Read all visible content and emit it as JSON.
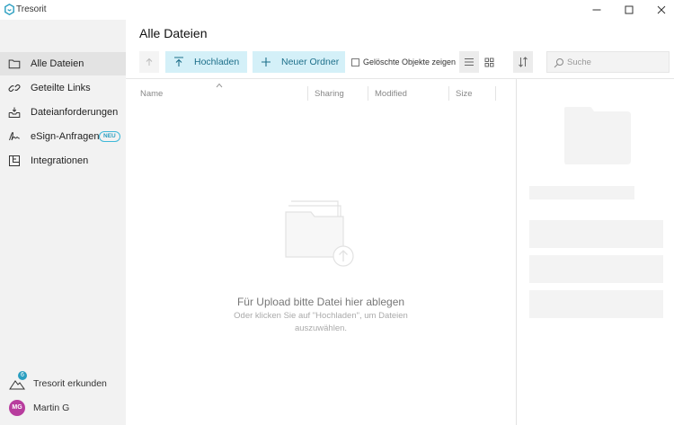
{
  "window": {
    "title": "Tresorit",
    "controls": {
      "minimize": "minimize-icon",
      "maximize": "maximize-icon",
      "close": "close-icon"
    }
  },
  "sidebar": {
    "items": [
      {
        "label": "Alle Dateien",
        "icon": "folder-icon",
        "active": true
      },
      {
        "label": "Geteilte Links",
        "icon": "link-icon",
        "active": false
      },
      {
        "label": "Dateianforderungen",
        "icon": "inbox-tray-icon",
        "active": false
      },
      {
        "label": "eSign-Anfragen",
        "icon": "signature-icon",
        "active": false,
        "badge": "NEU"
      },
      {
        "label": "Integrationen",
        "icon": "integrations-icon",
        "active": false
      }
    ],
    "explore": {
      "label": "Tresorit erkunden",
      "count": "6",
      "icon": "mountain-icon"
    },
    "user": {
      "name": "Martin G",
      "initials": "MG",
      "avatar_color": "#b83d9e"
    }
  },
  "main": {
    "title": "Alle Dateien",
    "toolbar": {
      "upload_label": "Hochladen",
      "new_folder_label": "Neuer Ordner",
      "show_deleted_label": "Gelöschte Objekte zeigen",
      "show_deleted_checked": false,
      "view_mode": "list",
      "search_placeholder": "Suche"
    },
    "columns": [
      "Name",
      "Sharing",
      "Modified",
      "Size"
    ],
    "empty_state": {
      "title": "Für Upload bitte Datei hier ablegen",
      "subtitle": "Oder klicken Sie auf \"Hochladen\", um Dateien auszuwählen."
    }
  },
  "colors": {
    "accent": "#2a9ec0",
    "accent_bg": "#d4f0f8",
    "accent_text": "#1d6f8a",
    "sidebar_bg": "#f2f2f2",
    "sidebar_active": "#e3e3e3"
  }
}
